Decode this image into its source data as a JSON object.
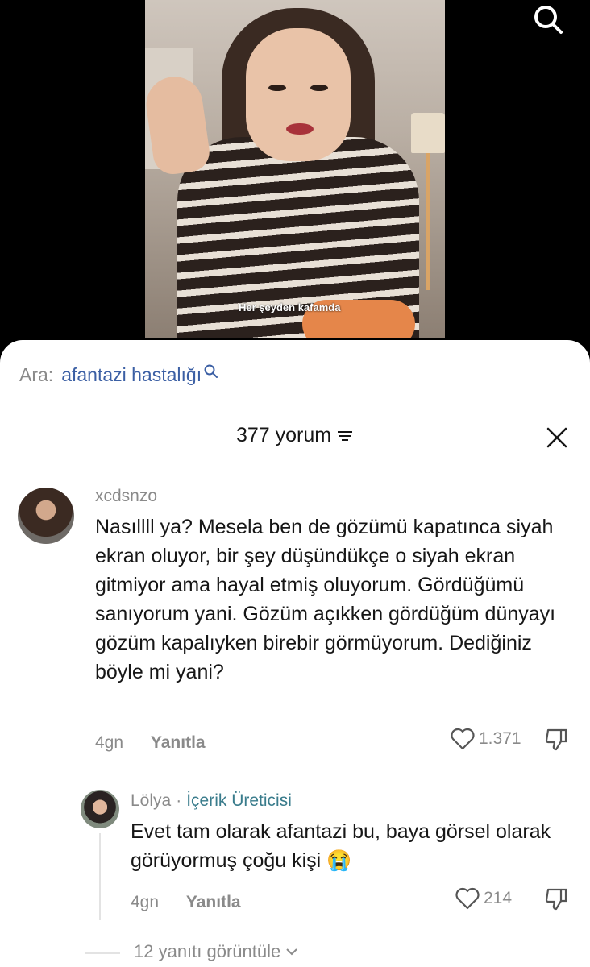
{
  "video": {
    "caption": "Her şeyden kafamda"
  },
  "search": {
    "prefix": "Ara:",
    "term": "afantazi hastalığı"
  },
  "comments_header": {
    "count_label": "377 yorum"
  },
  "comment": {
    "username": "xcdsnzo",
    "text": "Nasıllll ya? Mesela ben de gözümü kapatınca siyah ekran oluyor, bir şey düşündükçe o siyah ekran gitmiyor ama hayal etmiş oluyorum. Gördüğümü sanıyorum yani. Gözüm açıkken gördüğüm dünyayı gözüm kapalıyken birebir görmüyorum. Dediğiniz böyle mi yani?",
    "age": "4gn",
    "reply_label": "Yanıtla",
    "likes": "1.371"
  },
  "reply": {
    "username": "Lölya",
    "separator": "·",
    "badge": "İçerik Üreticisi",
    "text": "Evet tam olarak afantazi bu, baya görsel olarak görüyormuş çoğu kişi 😭",
    "age": "4gn",
    "reply_label": "Yanıtla",
    "likes": "214"
  },
  "view_replies": {
    "label": "12 yanıtı görüntüle"
  },
  "icons": {
    "search": "search-icon",
    "filter": "filter-icon",
    "close": "close-icon",
    "heart": "heart-icon",
    "dislike": "thumbs-down-icon",
    "chevron": "chevron-down-icon"
  },
  "colors": {
    "search_term": "#3b5fa4",
    "creator_badge": "#3a7c8c",
    "muted_text": "#8a8a8a"
  }
}
